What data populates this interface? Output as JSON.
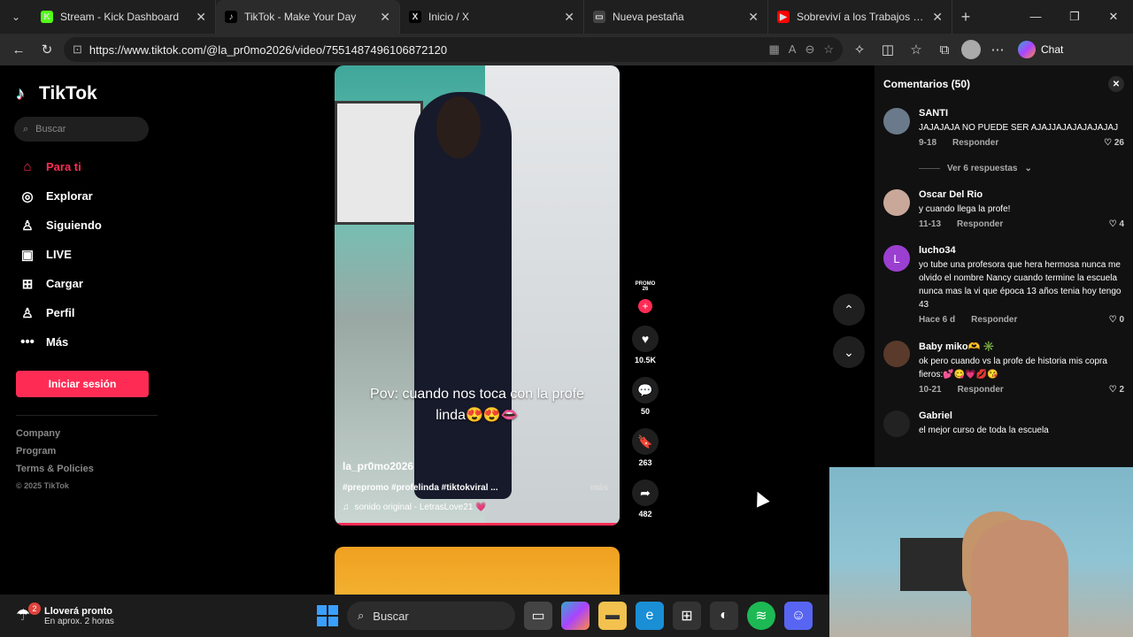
{
  "browser": {
    "tabs": [
      {
        "title": "Stream - Kick Dashboard",
        "icon": "kick-icon",
        "color": "#53fc18",
        "glyph": "K"
      },
      {
        "title": "TikTok - Make Your Day",
        "icon": "tiktok-icon",
        "color": "#000000",
        "glyph": "♪",
        "active": true
      },
      {
        "title": "Inicio / X",
        "icon": "x-icon",
        "color": "#000000",
        "glyph": "X"
      },
      {
        "title": "Nueva pestaña",
        "icon": "newtab-icon",
        "color": "#444444",
        "glyph": "▭"
      },
      {
        "title": "Sobreviví a los Trabajos Mas Pe",
        "icon": "youtube-icon",
        "color": "#ff0000",
        "glyph": "▶"
      }
    ],
    "url": "https://www.tiktok.com/@la_pr0mo2026/video/7551487496106872120",
    "chat_label": "Chat"
  },
  "tiktok": {
    "brand": "TikTok",
    "search_placeholder": "Buscar",
    "nav": [
      {
        "label": "Para ti",
        "icon": "home-icon",
        "glyph": "⌂",
        "active": true
      },
      {
        "label": "Explorar",
        "icon": "compass-icon",
        "glyph": "◎"
      },
      {
        "label": "Siguiendo",
        "icon": "person-icon",
        "glyph": "♙"
      },
      {
        "label": "LIVE",
        "icon": "live-icon",
        "glyph": "▣"
      },
      {
        "label": "Cargar",
        "icon": "upload-icon",
        "glyph": "⊞"
      },
      {
        "label": "Perfil",
        "icon": "profile-icon",
        "glyph": "♙"
      },
      {
        "label": "Más",
        "icon": "more-icon",
        "glyph": "•••"
      }
    ],
    "login_label": "Iniciar sesión",
    "footer": [
      "Company",
      "Program",
      "Terms & Policies"
    ],
    "copyright": "© 2025 TikTok",
    "accent": "#fe2c55"
  },
  "video": {
    "caption": "Pov: cuando nos toca con la profe linda😍😍👄",
    "username": "la_pr0mo2026",
    "hashtags": "#prepromo #profelinda #tiktokviral ...",
    "more": "más",
    "sound": "sonido original - LetrasLove21 💗",
    "promo_label": "PROMO 26",
    "likes": "10.5K",
    "comments": "50",
    "saves": "263",
    "shares": "482"
  },
  "comments": {
    "title": "Comentarios (50)",
    "items": [
      {
        "user": "SANTI",
        "text": "JAJAJAJA NO PUEDE SER AJAJJAJAJAJAJAJAJ",
        "date": "9-18",
        "reply": "Responder",
        "likes": "26",
        "avatar": "#6a7a8a",
        "initial": ""
      },
      {
        "user": "Oscar Del Rio",
        "text": "y cuando llega la profe!",
        "date": "11-13",
        "reply": "Responder",
        "likes": "4",
        "avatar": "#c9a89a",
        "initial": ""
      },
      {
        "user": "lucho34",
        "text": "yo tube una profesora que hera hermosa nunca me olvido el nombre Nancy cuando termine la escuela nunca mas la vi que época 13 años tenia hoy tengo 43",
        "date": "Hace 6 d",
        "reply": "Responder",
        "likes": "0",
        "avatar": "#9b3fd0",
        "initial": "L"
      },
      {
        "user": "Baby miko🫶 ✳️",
        "text": "ok pero cuando vs la profe de historia mis copra fieros:💕😋💗💋😘",
        "date": "10-21",
        "reply": "Responder",
        "likes": "2",
        "avatar": "#5a3a2a",
        "initial": ""
      },
      {
        "user": "Gabriel",
        "text": "el mejor curso de toda la escuela",
        "date": "",
        "reply": "",
        "likes": "",
        "avatar": "#222222",
        "initial": ""
      }
    ],
    "view_replies": "Ver 6 respuestas"
  },
  "taskbar": {
    "weather_title": "Lloverá pronto",
    "weather_sub": "En aprox. 2 horas",
    "weather_badge": "2",
    "search_placeholder": "Buscar"
  }
}
